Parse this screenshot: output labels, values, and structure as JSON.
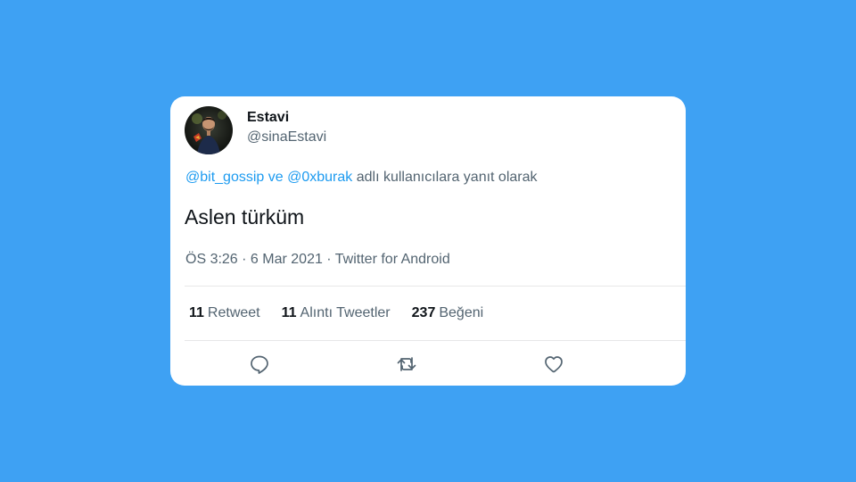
{
  "tweet": {
    "author": {
      "display_name": "Estavi",
      "handle": "@sinaEstavi"
    },
    "reply_to": {
      "mention_1": "@bit_gossip",
      "joiner": "ve",
      "mention_2": "@0xburak",
      "suffix": "adlı kullanıcılara yanıt olarak"
    },
    "text": "Aslen türküm",
    "meta": "ÖS 3:26 · 6 Mar 2021 · Twitter for Android",
    "stats": {
      "retweets_count": "11",
      "retweets_label": "Retweet",
      "quotes_count": "11",
      "quotes_label": "Alıntı Tweetler",
      "likes_count": "237",
      "likes_label": "Beğeni"
    },
    "actions": [
      "reply-icon",
      "retweet-icon",
      "like-icon"
    ]
  },
  "colors": {
    "background": "#3ea1f3",
    "card": "#ffffff",
    "link": "#1d9bf0",
    "secondary_text": "#536471",
    "primary_text": "#0f1419"
  }
}
